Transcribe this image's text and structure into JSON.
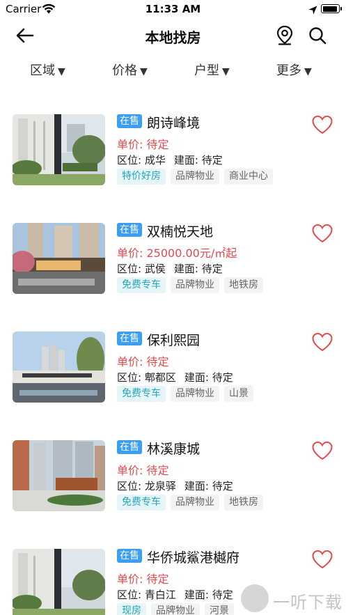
{
  "status_bar": {
    "carrier": "Carrier",
    "time": "11:33 AM"
  },
  "nav": {
    "title": "本地找房",
    "back_icon": "arrow-left-icon",
    "map_icon": "location-pin-icon",
    "search_icon": "search-icon"
  },
  "filters": [
    {
      "label": "区域",
      "arrow": "▼"
    },
    {
      "label": "价格",
      "arrow": "▼"
    },
    {
      "label": "户型",
      "arrow": "▼"
    },
    {
      "label": "更多",
      "arrow": "▼"
    }
  ],
  "listings": [
    {
      "status": "在售",
      "name": "朗诗峰境",
      "price_label": "单价:",
      "price": "待定",
      "district_label": "区位:",
      "district": "成华",
      "area_label": "建面:",
      "area": "待定",
      "tags": [
        {
          "text": "特价好房",
          "highlight": true
        },
        {
          "text": "品牌物业",
          "highlight": false
        },
        {
          "text": "商业中心",
          "highlight": false
        }
      ]
    },
    {
      "status": "在售",
      "name": "双楠悦天地",
      "price_label": "单价:",
      "price": "25000.00元/㎡起",
      "district_label": "区位:",
      "district": "武侯",
      "area_label": "建面:",
      "area": "待定",
      "tags": [
        {
          "text": "免费专车",
          "highlight": true
        },
        {
          "text": "品牌物业",
          "highlight": false
        },
        {
          "text": "地铁房",
          "highlight": false
        }
      ]
    },
    {
      "status": "在售",
      "name": "保利熙园",
      "price_label": "单价:",
      "price": "待定",
      "district_label": "区位:",
      "district": "郫都区",
      "area_label": "建面:",
      "area": "待定",
      "tags": [
        {
          "text": "免费专车",
          "highlight": true
        },
        {
          "text": "品牌物业",
          "highlight": false
        },
        {
          "text": "山景",
          "highlight": false
        }
      ]
    },
    {
      "status": "在售",
      "name": "林溪康城",
      "price_label": "单价:",
      "price": "待定",
      "district_label": "区位:",
      "district": "龙泉驿",
      "area_label": "建面:",
      "area": "待定",
      "tags": [
        {
          "text": "免费专车",
          "highlight": true
        },
        {
          "text": "品牌物业",
          "highlight": false
        },
        {
          "text": "地铁房",
          "highlight": false
        }
      ]
    },
    {
      "status": "在售",
      "name": "华侨城鯊港樾府",
      "price_label": "单价:",
      "price": "待定",
      "district_label": "区位:",
      "district": "青白江",
      "area_label": "建面:",
      "area": "待定",
      "tags": [
        {
          "text": "现房",
          "highlight": true
        },
        {
          "text": "品牌物业",
          "highlight": false
        },
        {
          "text": "河景",
          "highlight": false
        }
      ]
    }
  ],
  "watermark": {
    "text": "一听下载"
  },
  "colors": {
    "accent": "#3c9ef2",
    "price": "#e5484d",
    "favorite": "#e5484d",
    "tag_highlight": "#27a5bb"
  }
}
